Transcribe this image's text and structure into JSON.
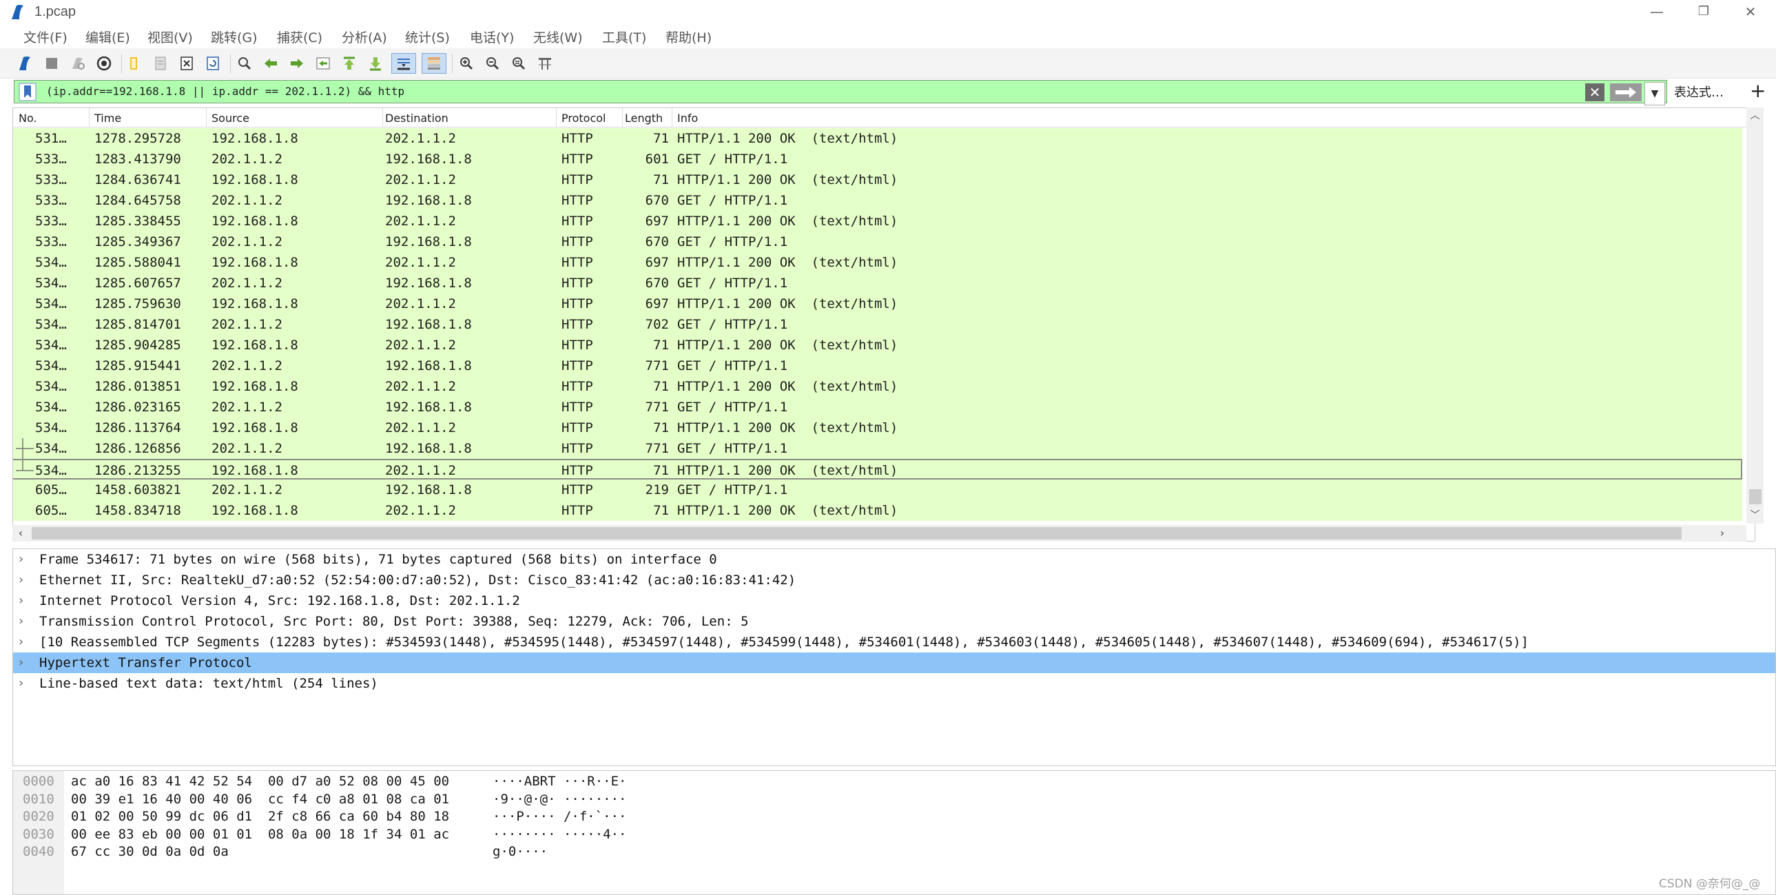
{
  "window": {
    "title": "1.pcap",
    "minimize": "—",
    "restore": "❐",
    "close": "✕"
  },
  "menu": [
    "文件(F)",
    "编辑(E)",
    "视图(V)",
    "跳转(G)",
    "捕获(C)",
    "分析(A)",
    "统计(S)",
    "电话(Y)",
    "无线(W)",
    "工具(T)",
    "帮助(H)"
  ],
  "toolbar": {
    "icons": [
      "shark-fin-start-icon",
      "stop-capture-icon",
      "restart-capture-icon",
      "capture-options-icon",
      "open-file-icon",
      "save-file-icon",
      "close-file-icon",
      "reload-file-icon",
      "find-packet-icon",
      "go-back-icon",
      "go-forward-icon",
      "go-to-packet-icon",
      "go-first-icon",
      "go-last-icon",
      "autoscroll-icon",
      "colorize-icon",
      "zoom-in-icon",
      "zoom-out-icon",
      "zoom-normal-icon",
      "resize-columns-icon"
    ],
    "active": [
      "autoscroll-icon",
      "colorize-icon"
    ]
  },
  "filter": {
    "value": "(ip.addr==192.168.1.8 || ip.addr == 202.1.1.2) && http",
    "background": "#afffaf",
    "expression_label": "表达式…",
    "add_label": "+"
  },
  "packet_list": {
    "columns": [
      "No.",
      "Time",
      "Source",
      "Destination",
      "Protocol",
      "Length",
      "Info"
    ],
    "row_color": "#e4ffc7",
    "rows": [
      {
        "no": "531…",
        "time": "1278.295728",
        "src": "192.168.1.8",
        "dst": "202.1.1.2",
        "proto": "HTTP",
        "len": "71",
        "info": "HTTP/1.1 200 OK  (text/html)"
      },
      {
        "no": "533…",
        "time": "1283.413790",
        "src": "202.1.1.2",
        "dst": "192.168.1.8",
        "proto": "HTTP",
        "len": "601",
        "info": "GET / HTTP/1.1"
      },
      {
        "no": "533…",
        "time": "1284.636741",
        "src": "192.168.1.8",
        "dst": "202.1.1.2",
        "proto": "HTTP",
        "len": "71",
        "info": "HTTP/1.1 200 OK  (text/html)"
      },
      {
        "no": "533…",
        "time": "1284.645758",
        "src": "202.1.1.2",
        "dst": "192.168.1.8",
        "proto": "HTTP",
        "len": "670",
        "info": "GET / HTTP/1.1"
      },
      {
        "no": "533…",
        "time": "1285.338455",
        "src": "192.168.1.8",
        "dst": "202.1.1.2",
        "proto": "HTTP",
        "len": "697",
        "info": "HTTP/1.1 200 OK  (text/html)"
      },
      {
        "no": "533…",
        "time": "1285.349367",
        "src": "202.1.1.2",
        "dst": "192.168.1.8",
        "proto": "HTTP",
        "len": "670",
        "info": "GET / HTTP/1.1"
      },
      {
        "no": "534…",
        "time": "1285.588041",
        "src": "192.168.1.8",
        "dst": "202.1.1.2",
        "proto": "HTTP",
        "len": "697",
        "info": "HTTP/1.1 200 OK  (text/html)"
      },
      {
        "no": "534…",
        "time": "1285.607657",
        "src": "202.1.1.2",
        "dst": "192.168.1.8",
        "proto": "HTTP",
        "len": "670",
        "info": "GET / HTTP/1.1"
      },
      {
        "no": "534…",
        "time": "1285.759630",
        "src": "192.168.1.8",
        "dst": "202.1.1.2",
        "proto": "HTTP",
        "len": "697",
        "info": "HTTP/1.1 200 OK  (text/html)"
      },
      {
        "no": "534…",
        "time": "1285.814701",
        "src": "202.1.1.2",
        "dst": "192.168.1.8",
        "proto": "HTTP",
        "len": "702",
        "info": "GET / HTTP/1.1"
      },
      {
        "no": "534…",
        "time": "1285.904285",
        "src": "192.168.1.8",
        "dst": "202.1.1.2",
        "proto": "HTTP",
        "len": "71",
        "info": "HTTP/1.1 200 OK  (text/html)"
      },
      {
        "no": "534…",
        "time": "1285.915441",
        "src": "202.1.1.2",
        "dst": "192.168.1.8",
        "proto": "HTTP",
        "len": "771",
        "info": "GET / HTTP/1.1"
      },
      {
        "no": "534…",
        "time": "1286.013851",
        "src": "192.168.1.8",
        "dst": "202.1.1.2",
        "proto": "HTTP",
        "len": "71",
        "info": "HTTP/1.1 200 OK  (text/html)"
      },
      {
        "no": "534…",
        "time": "1286.023165",
        "src": "202.1.1.2",
        "dst": "192.168.1.8",
        "proto": "HTTP",
        "len": "771",
        "info": "GET / HTTP/1.1"
      },
      {
        "no": "534…",
        "time": "1286.113764",
        "src": "192.168.1.8",
        "dst": "202.1.1.2",
        "proto": "HTTP",
        "len": "71",
        "info": "HTTP/1.1 200 OK  (text/html)"
      },
      {
        "no": "534…",
        "time": "1286.126856",
        "src": "202.1.1.2",
        "dst": "192.168.1.8",
        "proto": "HTTP",
        "len": "771",
        "info": "GET / HTTP/1.1"
      },
      {
        "no": "534…",
        "time": "1286.213255",
        "src": "192.168.1.8",
        "dst": "202.1.1.2",
        "proto": "HTTP",
        "len": "71",
        "info": "HTTP/1.1 200 OK  (text/html)",
        "selected": true
      },
      {
        "no": "605…",
        "time": "1458.603821",
        "src": "202.1.1.2",
        "dst": "192.168.1.8",
        "proto": "HTTP",
        "len": "219",
        "info": "GET / HTTP/1.1"
      },
      {
        "no": "605…",
        "time": "1458.834718",
        "src": "192.168.1.8",
        "dst": "202.1.1.2",
        "proto": "HTTP",
        "len": "71",
        "info": "HTTP/1.1 200 OK  (text/html)"
      }
    ]
  },
  "details": {
    "highlight_color": "#8cc4f8",
    "items": [
      {
        "text": "Frame 534617: 71 bytes on wire (568 bits), 71 bytes captured (568 bits) on interface 0"
      },
      {
        "text": "Ethernet II, Src: RealtekU_d7:a0:52 (52:54:00:d7:a0:52), Dst: Cisco_83:41:42 (ac:a0:16:83:41:42)"
      },
      {
        "text": "Internet Protocol Version 4, Src: 192.168.1.8, Dst: 202.1.1.2"
      },
      {
        "text": "Transmission Control Protocol, Src Port: 80, Dst Port: 39388, Seq: 12279, Ack: 706, Len: 5"
      },
      {
        "text": "[10 Reassembled TCP Segments (12283 bytes): #534593(1448), #534595(1448), #534597(1448), #534599(1448), #534601(1448), #534603(1448), #534605(1448), #534607(1448), #534609(694), #534617(5)]"
      },
      {
        "text": "Hypertext Transfer Protocol",
        "highlight": true
      },
      {
        "text": "Line-based text data: text/html (254 lines)"
      }
    ]
  },
  "bytes": [
    {
      "offset": "0000",
      "hex": "ac a0 16 83 41 42 52 54  00 d7 a0 52 08 00 45 00",
      "ascii": "····ABRT ···R··E·"
    },
    {
      "offset": "0010",
      "hex": "00 39 e1 16 40 00 40 06  cc f4 c0 a8 01 08 ca 01",
      "ascii": "·9··@·@· ········"
    },
    {
      "offset": "0020",
      "hex": "01 02 00 50 99 dc 06 d1  2f c8 66 ca 60 b4 80 18",
      "ascii": "···P···· /·f·`···"
    },
    {
      "offset": "0030",
      "hex": "00 ee 83 eb 00 00 01 01  08 0a 00 18 1f 34 01 ac",
      "ascii": "········ ·····4··"
    },
    {
      "offset": "0040",
      "hex": "67 cc 30 0d 0a 0d 0a",
      "ascii": "g·0····"
    }
  ],
  "watermark": "CSDN @奈何@_@"
}
